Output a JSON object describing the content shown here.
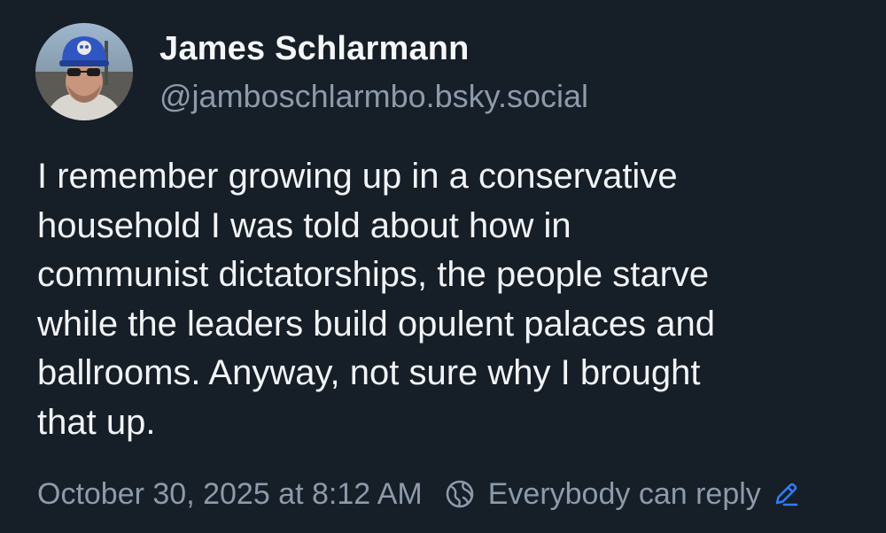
{
  "author": {
    "display_name": "James Schlarmann",
    "handle": "@jamboschlarmbo.bsky.social",
    "avatar_icon": "user-avatar-photo"
  },
  "post": {
    "lines": [
      "I remember growing up in a conservative",
      "household I was told about how in",
      "communist dictatorships, the people starve",
      "while the leaders build opulent palaces and",
      "ballrooms. Anyway, not sure why I brought",
      "that up."
    ]
  },
  "meta": {
    "timestamp": "October 30, 2025 at 8:12 AM",
    "reply_setting": "Everybody can reply",
    "reply_icon": "globe-icon",
    "edit_icon": "pencil-icon"
  },
  "colors": {
    "background": "#161e27",
    "primary_text": "#f1f3f5",
    "secondary_text": "#8c9aab",
    "accent": "#2f7cf6"
  }
}
